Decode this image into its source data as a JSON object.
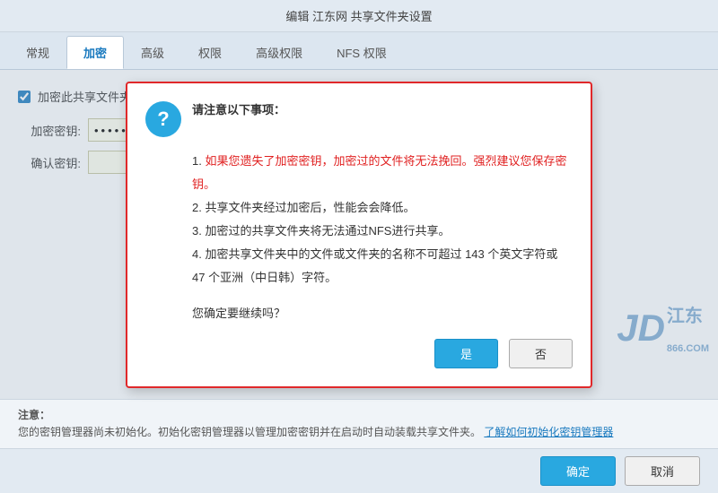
{
  "window": {
    "title": "编辑 江东网 共享文件夹设置"
  },
  "tabs": [
    {
      "label": "常规",
      "active": false
    },
    {
      "label": "加密",
      "active": true
    },
    {
      "label": "高级",
      "active": false
    },
    {
      "label": "权限",
      "active": false
    },
    {
      "label": "高级权限",
      "active": false
    },
    {
      "label": "NFS 权限",
      "active": false
    }
  ],
  "form": {
    "checkbox_label": "加密此共享文件夹",
    "password_label": "加密密钥:",
    "password_placeholder": "••••••••••••••••",
    "confirm_label": "确认密钥:",
    "confirm_placeholder": ""
  },
  "dialog": {
    "title": "请注意以下事项：",
    "icon_symbol": "?",
    "items": [
      {
        "index": 1,
        "text": "如果您遗失了加密密钥，加密过的文件将无法挽回。强烈建议您保存密钥。",
        "highlight": true
      },
      {
        "index": 2,
        "text": "共享文件夹经过加密后，性能会会降低。",
        "highlight": false
      },
      {
        "index": 3,
        "text": "加密过的共享文件夹将无法通过NFS进行共享。",
        "highlight": false
      },
      {
        "index": 4,
        "text": "加密共享文件夹中的文件或文件夹的名称不可超过 143 个英文字符或 47 个亚洲（中日韩）字符。",
        "highlight": false
      }
    ],
    "question": "您确定要继续吗？",
    "yes_label": "是",
    "no_label": "否"
  },
  "bottom_note": {
    "title": "注意：",
    "text": "您的密钥管理器尚未初始化。初始化密钥管理器以管理加密密钥并在启动时自动装载共享文件夹。",
    "link_text": "了解如何初始化密钥管理器"
  },
  "action_bar": {
    "confirm_label": "确定",
    "cancel_label": "取消"
  },
  "watermark": {
    "jd": "JD",
    "cn": "江东",
    "url": "866.COM"
  }
}
